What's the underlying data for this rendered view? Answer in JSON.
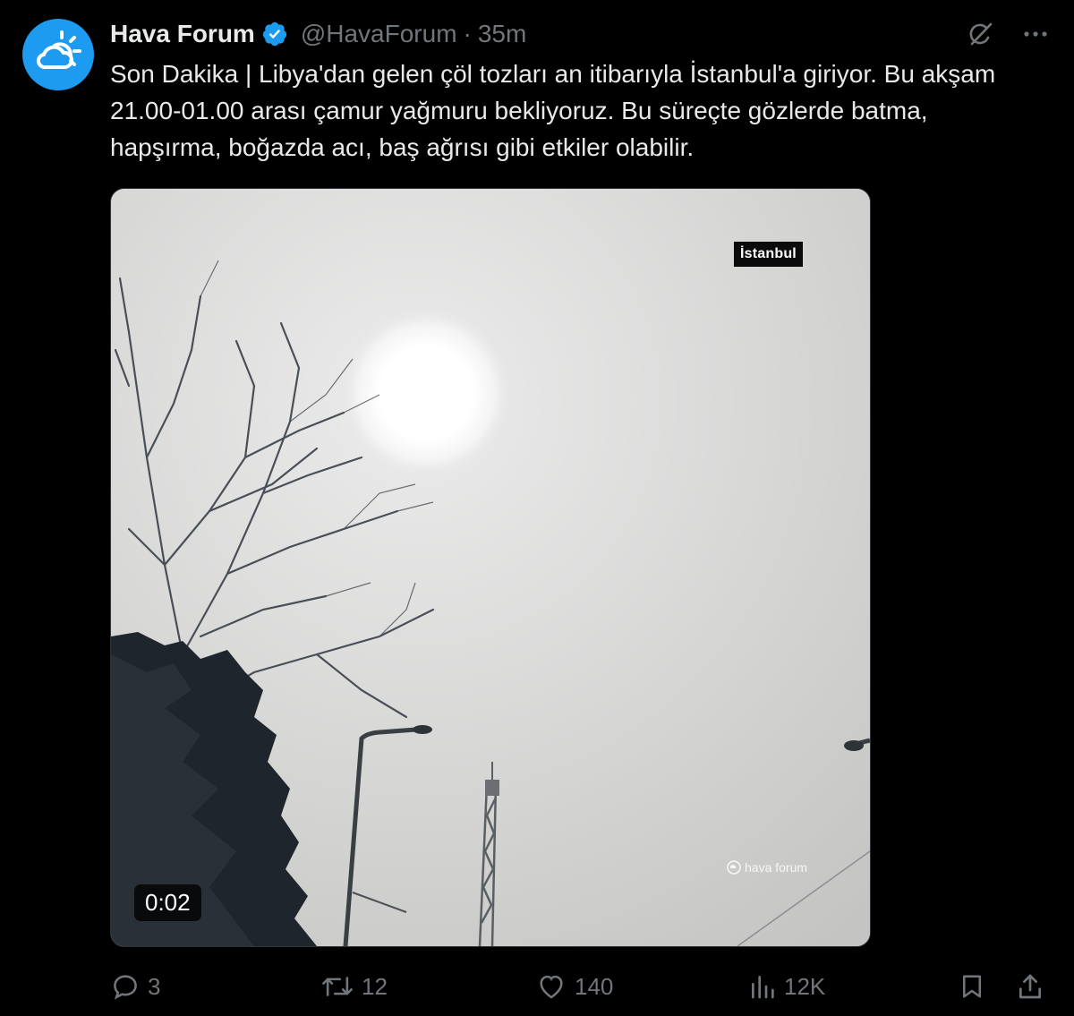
{
  "tweet": {
    "author_name": "Hava Forum",
    "handle": "@HavaForum",
    "separator": "·",
    "time": "35m",
    "text": "Son Dakika | Libya'dan gelen çöl tozları an itibarıyla İstanbul'a giriyor. Bu akşam 21.00-01.00 arası çamur yağmuru bekliyoruz. Bu süreçte gözlerde batma, hapşırma, boğazda acı, baş ağrısı gibi etkiler olabilir."
  },
  "media": {
    "location_badge": "İstanbul",
    "watermark": "hava forum",
    "duration": "0:02",
    "video_progress": 0
  },
  "actions": {
    "replies": "3",
    "reposts": "12",
    "likes": "140",
    "views": "12K"
  },
  "colors": {
    "background": "#000000",
    "text_primary": "#e7e9ea",
    "text_secondary": "#71767b",
    "verified_badge": "#1d9bf0",
    "avatar_bg": "#1d9bf0"
  },
  "icons": {
    "avatar": "cloud-sun-logo",
    "verified": "verified-badge-icon",
    "grok": "grok-icon",
    "more": "more-icon",
    "reply": "reply-icon",
    "repost": "repost-icon",
    "like": "like-icon",
    "views": "views-icon",
    "bookmark": "bookmark-icon",
    "share": "share-icon"
  }
}
